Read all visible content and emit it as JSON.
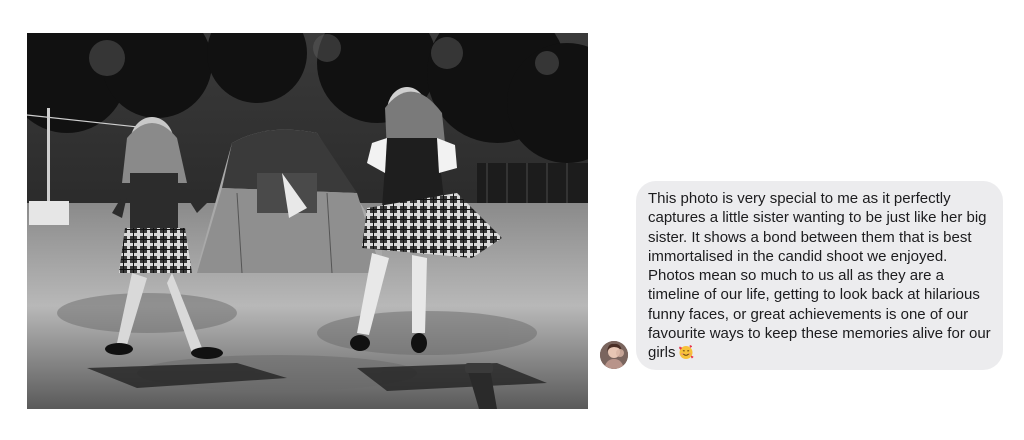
{
  "message": {
    "text": "This photo is very special to me as it perfectly captures a little sister wanting to be just like her big sister. It shows a bond between them that is best immortalised in the candid shoot we enjoyed. Photos mean so much to us all as they are a timeline of our life, getting to look back at hilarious funny faces, or great achievements is one of our favourite ways to keep these memories alive for our girls",
    "emoji": "smiling-face-with-hearts",
    "bubble_color": "#ececee",
    "text_color": "#1c1c1e"
  },
  "photo": {
    "style": "black-and-white",
    "subject": "two girls dancing in kilts in a garden with a tent"
  },
  "avatar": {
    "icon": "user-avatar"
  }
}
